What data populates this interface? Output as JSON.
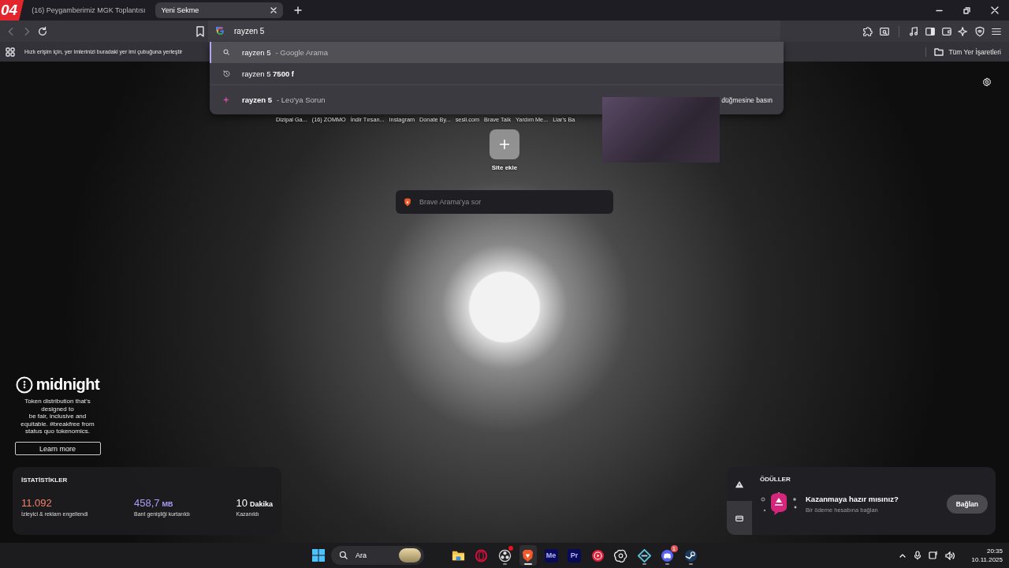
{
  "video_badge": "04",
  "tabs": [
    {
      "label": "(16) Peygamberimiz MGK Toplantısı",
      "selected": false
    },
    {
      "label": "Yeni Sekme",
      "selected": true
    }
  ],
  "toolbar": {
    "nav": [
      {
        "kind": "back",
        "disabled": true
      },
      {
        "kind": "forward",
        "disabled": true
      },
      {
        "kind": "reload",
        "disabled": false
      }
    ],
    "address": "rayzen 5",
    "tools": [
      {
        "kind": "extensions"
      },
      {
        "kind": "page-search"
      },
      {
        "kind": "divider"
      },
      {
        "kind": "media"
      },
      {
        "kind": "sidebar"
      },
      {
        "kind": "wallet"
      },
      {
        "kind": "leo"
      },
      {
        "kind": "vpn"
      },
      {
        "kind": "menu"
      }
    ]
  },
  "bookmarks_bar": {
    "hint": "Hızlı erişim için, yer imlerinizi buradaki yer imi çubuğuna yerleştir",
    "all_bookmarks": "Tüm Yer İşaretleri"
  },
  "omnibox_suggestions": [
    {
      "kind": "search",
      "text": "rayzen 5",
      "detail": "- Google Arama",
      "selected": true
    },
    {
      "kind": "history",
      "text": "rayzen 5 **7500 f**",
      "selected": false
    },
    {
      "kind": "leo",
      "text": "rayzen 5",
      "detail": "- Leo'ya Sorun",
      "hint": "düğmesine basın",
      "selected": false
    }
  ],
  "new_tab_page": {
    "top_sites": [
      "Dizipal Ga...",
      "(16) ZOMMO",
      "İndir Tırsan...",
      "Instagram",
      "Donate By...",
      "sesli.com",
      "Brave Talk",
      "Yardım Me...",
      "Liar's Ba"
    ],
    "add_site": "Site ekle",
    "search_placeholder": "Brave Arama'ya sor",
    "sponsored": {
      "brand": "midnight",
      "text": "Token distribution that’s\ndesigned to\nbe fair, inclusive and\nequitable. #breakfree from\nstatus quo tokenomics.",
      "button": "Learn more"
    },
    "stats": {
      "title": "İSTATİSTİKLER",
      "items": [
        {
          "value": "11.092",
          "label": "İzleyici & reklam engellendi",
          "color": "#f0826c"
        },
        {
          "value": "458,7",
          "unit": "MB",
          "label": "Bant genişliği kurtarıldı",
          "color": "#a99cf5"
        },
        {
          "value": "10",
          "unit": "Dakika",
          "label": "Kazanıldı",
          "color": "#ffffff"
        }
      ]
    },
    "rewards": {
      "tabs": [
        {
          "kind": "alert",
          "selected": false
        },
        {
          "kind": "card",
          "selected": true
        }
      ],
      "title": "ÖDÜLLER",
      "heading": "Kazanmaya hazır mısınız?",
      "subtitle": "Bir ödeme hesabına bağlan",
      "button": "Bağlan"
    }
  },
  "taskbar": {
    "search_placeholder": "Ara",
    "apps": [
      {
        "kind": "explorer",
        "running": false,
        "selected": false,
        "alert": false
      },
      {
        "kind": "ring",
        "running": false,
        "selected": false,
        "alert": false
      },
      {
        "kind": "aperture",
        "running": true,
        "selected": false,
        "alert": true
      },
      {
        "kind": "lion",
        "running": true,
        "selected": true,
        "alert": false
      },
      {
        "kind": "tile",
        "label": "Me",
        "running": false,
        "selected": false,
        "alert": false
      },
      {
        "kind": "tile",
        "label": "Pr",
        "running": false,
        "selected": false,
        "alert": false
      },
      {
        "kind": "play",
        "running": false,
        "selected": false,
        "alert": false
      },
      {
        "kind": "knot",
        "running": false,
        "selected": false,
        "alert": false
      },
      {
        "kind": "cube",
        "running": true,
        "selected": false,
        "alert": false
      },
      {
        "kind": "chat",
        "badge": "1",
        "running": true,
        "selected": false,
        "alert": false
      },
      {
        "kind": "wheel",
        "running": true,
        "selected": false,
        "alert": false
      }
    ],
    "time": "20:35",
    "date": "10.11.2025"
  }
}
